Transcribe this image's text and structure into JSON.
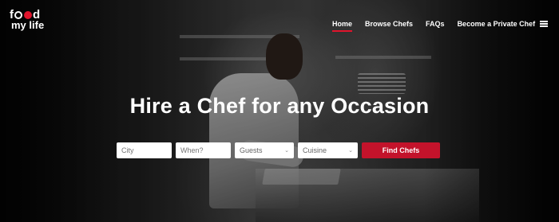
{
  "logo": {
    "line1_a": "f",
    "line1_b": "d",
    "line2": "my life"
  },
  "nav": {
    "items": [
      {
        "label": "Home",
        "active": true
      },
      {
        "label": "Browse Chefs"
      },
      {
        "label": "FAQs"
      },
      {
        "label": "Become a Private Chef"
      }
    ],
    "menu_icon": "hamburger-menu-icon"
  },
  "hero": {
    "title": "Hire a Chef for any Occasion"
  },
  "search": {
    "city_placeholder": "City",
    "when_placeholder": "When?",
    "guests_value": "Guests",
    "cuisine_value": "Cuisine",
    "submit_label": "Find Chefs"
  },
  "colors": {
    "accent": "#c3132b",
    "logo_red": "#e0142c"
  }
}
